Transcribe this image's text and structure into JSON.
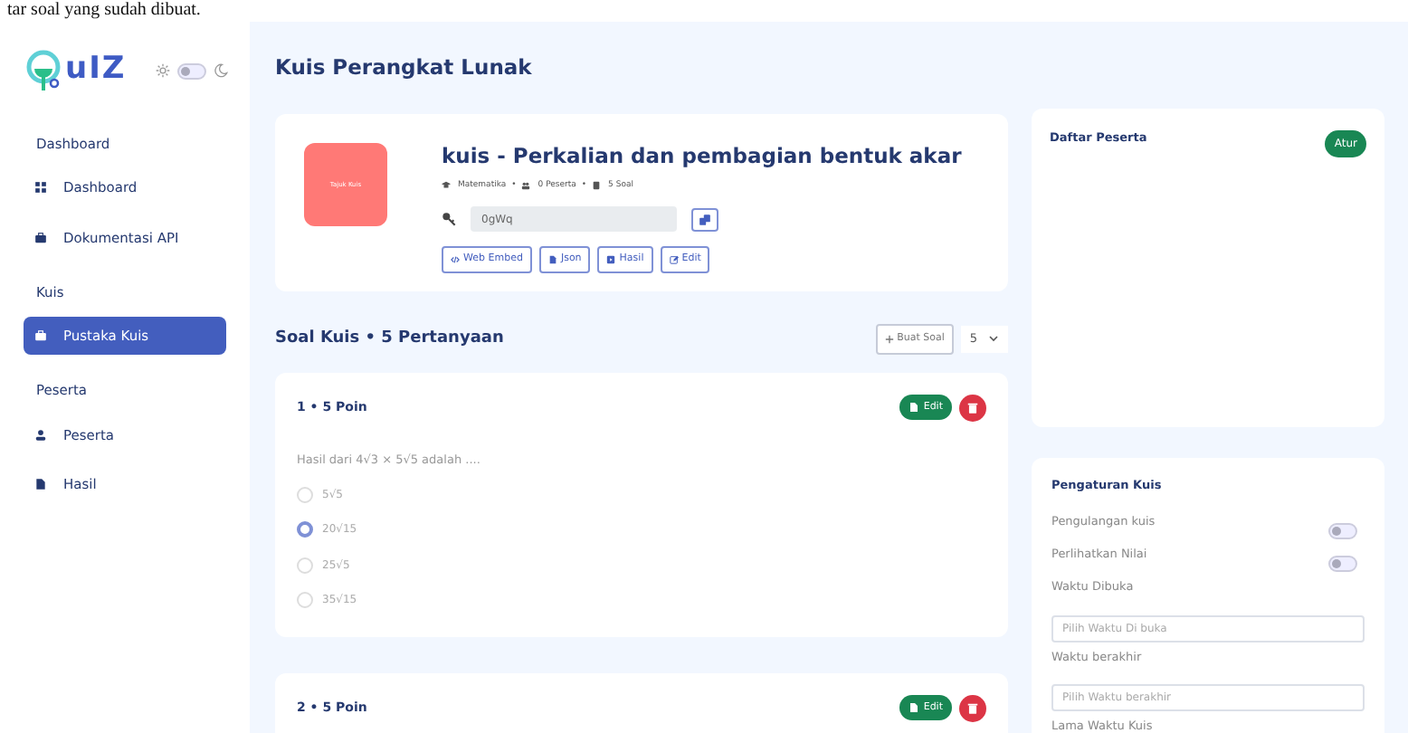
{
  "document_text": "tar soal yang sudah dibuat.",
  "logo": {
    "text": "uIZ"
  },
  "theme_switch": {
    "on": false
  },
  "sidebar": {
    "sections": [
      {
        "heading": "Dashboard",
        "items": [
          {
            "label": "Dashboard",
            "selected": false
          },
          {
            "label": "Dokumentasi API",
            "selected": false
          }
        ]
      },
      {
        "heading": "Kuis",
        "items": [
          {
            "label": "Pustaka Kuis",
            "selected": true
          }
        ]
      },
      {
        "heading": "Peserta",
        "items": [
          {
            "label": "Peserta",
            "selected": false
          },
          {
            "label": "Hasil",
            "selected": false
          }
        ]
      }
    ]
  },
  "page_title": "Kuis Perangkat Lunak",
  "quiz": {
    "cover_text": "Tajuk Kuis",
    "title": "kuis - Perkalian dan pembagian bentuk akar",
    "meta": [
      {
        "text": "Matematika"
      },
      {
        "separator": "•",
        "text": "0 Peserta"
      },
      {
        "separator": "•",
        "text": "5 Soal"
      }
    ],
    "code": "0gWq",
    "actions": [
      {
        "label": "Web Embed"
      },
      {
        "label": "Json"
      },
      {
        "label": "Hasil"
      },
      {
        "label": "Edit"
      }
    ]
  },
  "questions_header": {
    "title": "Soal Kuis • 5 Pertanyaan",
    "add_button": "Buat Soal",
    "per_page": "5"
  },
  "questions": [
    {
      "header": "1 • 5 Poin",
      "edit_label": "Edit",
      "text": "Hasil dari 4√3  ×  5√5 adalah ....",
      "options": [
        {
          "text": "5√5",
          "selected": false
        },
        {
          "text": "20√15",
          "selected": true
        },
        {
          "text": "25√5",
          "selected": false
        },
        {
          "text": "35√15",
          "selected": false
        }
      ]
    },
    {
      "header": "2 • 5 Poin",
      "edit_label": "Edit"
    }
  ],
  "participants": {
    "title": "Daftar Peserta",
    "button": "Atur"
  },
  "settings": {
    "title": "Pengaturan Kuis",
    "toggles": [
      {
        "label": "Pengulangan kuis",
        "on": false
      },
      {
        "label": "Perlihatkan Nilai",
        "on": false
      }
    ],
    "fields": [
      {
        "label": "Waktu Dibuka",
        "placeholder": "Pilih Waktu Di buka"
      },
      {
        "label": "Waktu berakhir",
        "placeholder": "Pilih Waktu berakhir"
      }
    ],
    "trailing_label": "Lama Waktu Kuis"
  }
}
